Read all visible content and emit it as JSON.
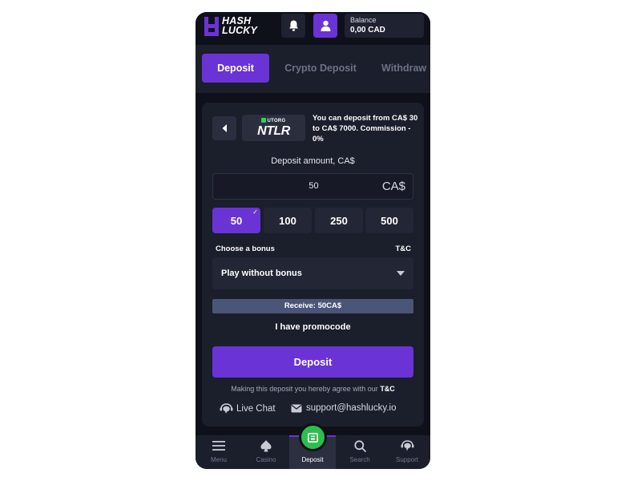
{
  "header": {
    "logo_line1": "HASH",
    "logo_line2": "LUCKY",
    "notifications_icon": "bell-icon",
    "profile_icon": "user-icon",
    "balance_label": "Balance",
    "balance_value": "0,00 CAD"
  },
  "tabs": [
    {
      "label": "Deposit",
      "active": true
    },
    {
      "label": "Crypto Deposit",
      "active": false
    },
    {
      "label": "Withdraw",
      "active": false
    }
  ],
  "deposit": {
    "method_brand": "UTORG",
    "method_name": "NTLR",
    "info_text": "You can deposit from CA$ 30 to CA$ 7000. Commission - 0%",
    "amount_label": "Deposit amount, CA$",
    "amount_value": "50",
    "currency": "CA$",
    "presets": [
      "50",
      "100",
      "250",
      "500"
    ],
    "selected_preset": "50",
    "bonus_label": "Choose a bonus",
    "tc_link": "T&C",
    "bonus_value": "Play without bonus",
    "receive_text": "Receive: 50CA$",
    "promocode_label": "I have promocode",
    "submit_label": "Deposit",
    "agree_text": "Making this deposit you hereby agree with our",
    "agree_link": "T&C",
    "live_chat_label": "Live Chat",
    "support_email": "support@hashlucky.io"
  },
  "bottom_nav": [
    {
      "label": "Menu",
      "icon": "menu-icon"
    },
    {
      "label": "Casino",
      "icon": "spade-icon"
    },
    {
      "label": "Deposit",
      "icon": "wallet-icon",
      "active": true
    },
    {
      "label": "Search",
      "icon": "search-icon"
    },
    {
      "label": "Support",
      "icon": "headset-icon"
    }
  ],
  "colors": {
    "background": "#0f111a",
    "panel": "#1b1e2b",
    "accent": "#6a33d6",
    "fab_green": "#2fbd4e",
    "receive_bar": "#4b5577"
  }
}
